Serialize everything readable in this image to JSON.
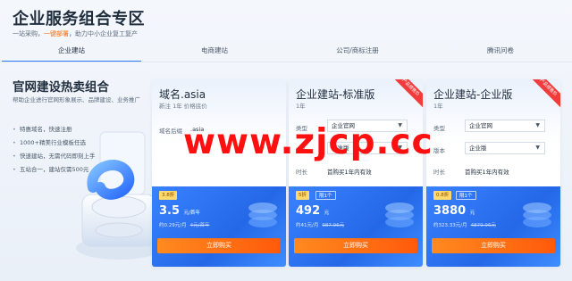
{
  "header": {
    "title": "企业服务组合专区",
    "subtitle_pre": "一站采购，",
    "subtitle_highlight": "一键部署",
    "subtitle_post": "，助力中小企业复工复产"
  },
  "tabs": [
    {
      "label": "企业建站",
      "active": true
    },
    {
      "label": "电商建站",
      "active": false
    },
    {
      "label": "公司/商标注册",
      "active": false
    },
    {
      "label": "腾讯问卷",
      "active": false
    }
  ],
  "promo": {
    "title": "官网建设热卖组合",
    "description": "帮助企业进行官网形象展示、品牌建设、业务推广",
    "features": [
      "特惠域名，快速注册",
      "1000+精美行业模板任选",
      "快速建站，无需代码即刻上手",
      "五站合一，建站仅需500元"
    ]
  },
  "cards": [
    {
      "name": "域名.asia",
      "sub": "新注 1年 价格底价",
      "rows": [
        {
          "label": "域名后缀",
          "value": ".asia",
          "type": "text"
        }
      ],
      "badge": "3.8折",
      "badge2": "",
      "ribbon": "",
      "price": "3.5",
      "price_unit": "元/首年",
      "price_sub": "约0.29元/月",
      "price_orig": "4元/首年",
      "buy_label": "立即购买"
    },
    {
      "name": "企业建站-标准版",
      "sub": "1年",
      "rows": [
        {
          "label": "类型",
          "value": "企业官网",
          "type": "select"
        },
        {
          "label": "版本",
          "value": "标准版",
          "type": "select"
        },
        {
          "label": "时长",
          "value": "首购买1年内有效",
          "type": "text"
        }
      ],
      "badge": "5折",
      "badge2": "限1个",
      "ribbon": "产品搭售价",
      "price": "492",
      "price_unit": "元",
      "price_sub": "约41元/月",
      "price_orig": "987.96元",
      "buy_label": "立即购买"
    },
    {
      "name": "企业建站-企业版",
      "sub": "1年",
      "rows": [
        {
          "label": "类型",
          "value": "企业官网",
          "type": "select"
        },
        {
          "label": "版本",
          "value": "企业版",
          "type": "select"
        },
        {
          "label": "时长",
          "value": "首购买1年内有效",
          "type": "text"
        }
      ],
      "badge": "0.8折",
      "badge2": "限1个",
      "ribbon": "产品搭售价",
      "price": "3880",
      "price_unit": "元",
      "price_sub": "约323.33元/月",
      "price_orig": "4879.96元",
      "buy_label": "立即购买"
    }
  ],
  "watermark": "www.zjcp.cc",
  "colors": {
    "accent": "#2f7cff",
    "highlight": "#ff6a00",
    "buy": "#ff6a10",
    "watermark": "#ff1010"
  }
}
